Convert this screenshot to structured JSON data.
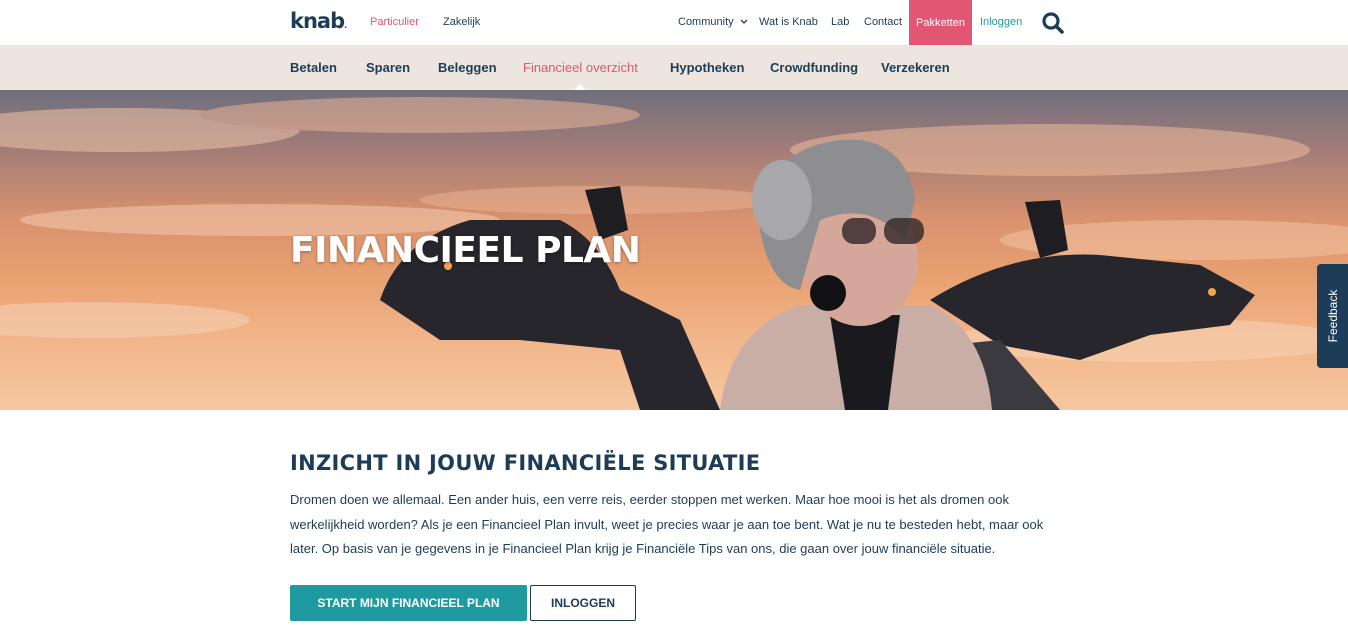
{
  "brand": {
    "logo": "knab",
    "accent": "#e25573",
    "teal": "#1f9aa0",
    "navy": "#1c3c58",
    "nav_bg": "#ede6df"
  },
  "segments": {
    "particulier": "Particulier",
    "zakelijk": "Zakelijk"
  },
  "topnav": {
    "community": "Community",
    "wat_is_knab": "Wat is Knab",
    "lab": "Lab",
    "contact": "Contact",
    "pakketten": "Pakketten",
    "inloggen": "Inloggen",
    "search_icon": "search-icon",
    "chevron_icon": "chevron-down-icon"
  },
  "mainnav": {
    "items": [
      {
        "label": "Betalen"
      },
      {
        "label": "Sparen"
      },
      {
        "label": "Beleggen"
      },
      {
        "label": "Financieel overzicht"
      },
      {
        "label": "Hypotheken"
      },
      {
        "label": "Crowdfunding"
      },
      {
        "label": "Verzekeren"
      }
    ],
    "active_index": 3
  },
  "hero": {
    "title": "FINANCIEEL PLAN"
  },
  "feedback": {
    "label": "Feedback"
  },
  "content": {
    "title": "INZICHT IN JOUW FINANCIËLE SITUATIE",
    "body": "Dromen doen we allemaal. Een ander huis, een verre reis, eerder stoppen met werken. Maar hoe mooi is het als dromen ook werkelijkheid worden? Als je een Financieel Plan invult, weet je precies waar je aan toe bent. Wat je nu te besteden hebt, maar ook later. Op basis van je gegevens in je Financieel Plan krijg je Financiële Tips van ons, die gaan over jouw financiële situatie.",
    "primary_button": "START MIJN FINANCIEEL PLAN",
    "secondary_button": "INLOGGEN"
  }
}
